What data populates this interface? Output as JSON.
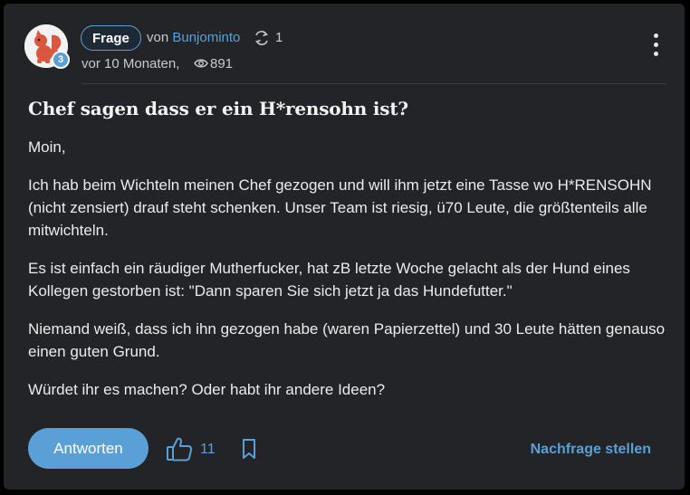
{
  "post": {
    "category_label": "Frage",
    "author_prefix": "von",
    "author": "Bunjominto",
    "edit_count": "1",
    "time": "vor 10 Monaten,",
    "views": "891",
    "level": "3",
    "title": "Chef sagen dass er ein H*rensohn ist?",
    "paragraphs": [
      "Moin,",
      "Ich hab beim Wichteln meinen Chef gezogen und will ihm jetzt eine Tasse wo H*RENSOHN (nicht zensiert) drauf steht schenken. Unser Team ist riesig, ü70 Leute, die größtenteils alle mitwichteln.",
      "Es ist einfach ein räudiger Mutherfucker, hat zB letzte Woche gelacht als der Hund eines Kollegen gestorben ist: \"Dann sparen Sie sich jetzt ja das Hundefutter.\"",
      "Niemand weiß, dass ich ihn gezogen habe (waren Papierzettel) und 30 Leute hätten genauso einen guten Grund.",
      "Würdet ihr es machen? Oder habt ihr andere Ideen?"
    ]
  },
  "actions": {
    "answer_label": "Antworten",
    "like_count": "11",
    "followup_label": "Nachfrage stellen"
  },
  "icons": {
    "avatar": "squirrel-avatar",
    "edit": "edit-history-icon",
    "views": "eye-icon",
    "menu": "more-vertical-icon",
    "like": "thumbs-up-icon",
    "bookmark": "bookmark-icon"
  },
  "colors": {
    "accent": "#5aa0d6",
    "card_bg": "#232427",
    "avatar_squirrel": "#d9573f"
  }
}
